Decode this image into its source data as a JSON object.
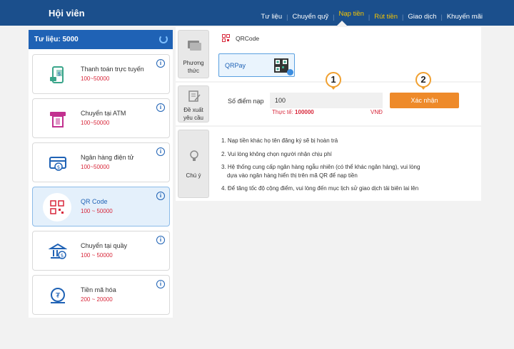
{
  "header": {
    "brand": "Hội viên",
    "nav": [
      {
        "label": "Tư liệu",
        "active": false
      },
      {
        "label": "Chuyển quỹ",
        "active": false
      },
      {
        "label": "Nạp tiền",
        "active": true
      },
      {
        "label": "Rút tiền",
        "active": false
      },
      {
        "label": "Giao dịch",
        "active": false
      },
      {
        "label": "Khuyến mãi",
        "active": false
      }
    ]
  },
  "sidebar": {
    "title": "Tư liệu: 5000",
    "refresh_icon": "refresh-icon",
    "items": [
      {
        "title": "Thanh toán trực tuyến",
        "range": "100~50000",
        "icon": "mobile-pay-icon"
      },
      {
        "title": "Chuyển tại ATM",
        "range": "100~50000",
        "icon": "atm-icon"
      },
      {
        "title": "Ngân hàng điện tử",
        "range": "100~50000",
        "icon": "ebank-icon"
      },
      {
        "title": "QR Code",
        "range": "100 ~ 50000",
        "icon": "qr-code-icon",
        "selected": true
      },
      {
        "title": "Chuyển tại quầy",
        "range": "100 ~ 50000",
        "icon": "bank-counter-icon"
      },
      {
        "title": "Tiền mã hóa",
        "range": "200 ~ 20000",
        "icon": "crypto-icon"
      }
    ]
  },
  "method": {
    "label_line1": "Phương",
    "label_line2": "thức",
    "tab_label": "QRCode",
    "option_label": "QRPay"
  },
  "request": {
    "label_line1": "Đề xuất",
    "label_line2": "yêu cầu",
    "field_label": "Số điểm nạp",
    "field_value": "100",
    "real_prefix": "Thực tế:",
    "real_value": "100000",
    "unit": "VNĐ",
    "confirm_label": "Xác nhận",
    "marker1": "1",
    "marker2": "2"
  },
  "notes": {
    "label": "Chú ý",
    "lines": [
      "1. Nạp tiền khác họ tên đăng ký sẽ bị hoàn trả",
      "2. Vui lòng không chọn người nhận chịu phí",
      "3. Hệ thống cung cấp ngân hàng ngẫu nhiên (có thể khác ngân hàng), vui lòng",
      "dựa vào ngân hàng hiển thị trên mã QR để nạp tiền",
      "4. Để tăng tốc độ cộng điểm, vui lòng đến mục lịch sử giao dịch tải biên lai lên"
    ]
  },
  "colors": {
    "header": "#1b4f8c",
    "accent": "#1f62b5",
    "confirm": "#ee8a2a",
    "red": "#d8273a",
    "active_nav": "#f5c400"
  }
}
